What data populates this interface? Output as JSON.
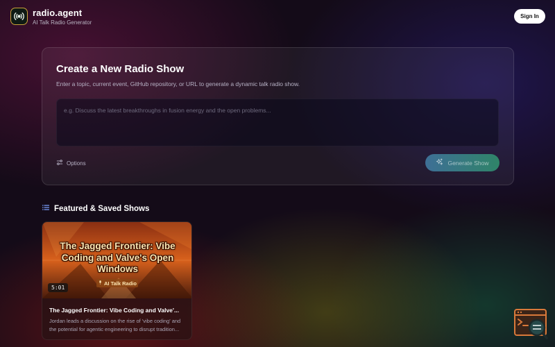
{
  "app": {
    "name": "radio.agent",
    "subtitle": "AI Talk Radio Generator",
    "logo_icon": "broadcast-icon",
    "sign_in_label": "Sign In"
  },
  "create": {
    "title": "Create a New Radio Show",
    "description": "Enter a topic, current event, GitHub repository, or URL to generate a dynamic talk radio show.",
    "input_value": "",
    "input_placeholder": "e.g. Discuss the latest breakthroughs in fusion energy and the open problems...",
    "options_label": "Options",
    "options_icon": "sliders-icon",
    "generate_label": "Generate Show",
    "generate_icon": "sparkles-icon"
  },
  "featured": {
    "heading": "Featured & Saved Shows",
    "heading_icon": "list-icon",
    "shows": [
      {
        "thumbnail_title": "The Jagged Frontier: Vibe Coding and Valve's Open Windows",
        "thumbnail_brand": "AI Talk Radio",
        "duration": "5:01",
        "title": "The Jagged Frontier: Vibe Coding and Valve'...",
        "description": "Jordan leads a discussion on the rise of 'vibe coding' and the potential for agentic engineering to disrupt tradition..."
      }
    ]
  },
  "colors": {
    "accent_gold": "#c9a23a",
    "generate_start": "#3e6f96",
    "generate_end": "#2f8468",
    "thumbnail_orange": "#d8611c"
  }
}
